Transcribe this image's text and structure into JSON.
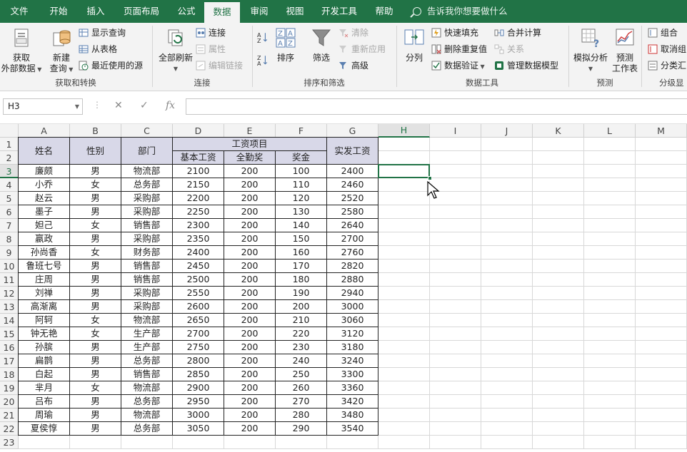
{
  "ribbon_tabs": [
    "文件",
    "开始",
    "插入",
    "页面布局",
    "公式",
    "数据",
    "审阅",
    "视图",
    "开发工具",
    "帮助"
  ],
  "active_tab": "数据",
  "tell_me": "告诉我你想要做什么",
  "groups": {
    "get_transform": {
      "label": "获取和转换",
      "get_external": [
        "获取",
        "外部数据"
      ],
      "new_query": [
        "新建",
        "查询"
      ],
      "show_queries": "显示查询",
      "from_table": "从表格",
      "recent_sources": "最近使用的源"
    },
    "connections": {
      "label": "连接",
      "refresh_all": "全部刷新",
      "connections": "连接",
      "properties": "属性",
      "edit_links": "编辑链接"
    },
    "sort_filter": {
      "label": "排序和筛选",
      "sort": "排序",
      "filter": "筛选",
      "clear": "清除",
      "reapply": "重新应用",
      "advanced": "高级"
    },
    "data_tools": {
      "label": "数据工具",
      "text_to_columns": "分列",
      "flash_fill": "快速填充",
      "remove_duplicates": "删除重复值",
      "data_validation": "数据验证",
      "consolidate": "合并计算",
      "relationships": "关系",
      "manage_model": "管理数据模型"
    },
    "forecast": {
      "label": "预测",
      "what_if": "模拟分析",
      "forecast_sheet": [
        "预测",
        "工作表"
      ]
    },
    "outline": {
      "label": "分级显",
      "group": "组合",
      "ungroup": "取消组",
      "subtotal": "分类汇"
    }
  },
  "name_box": "H3",
  "formula_value": "",
  "columns": [
    "A",
    "B",
    "C",
    "D",
    "E",
    "F",
    "G",
    "H",
    "I",
    "J",
    "K",
    "L",
    "M"
  ],
  "rows": [
    "1",
    "2",
    "3",
    "4",
    "5",
    "6",
    "7",
    "8",
    "9",
    "10",
    "11",
    "12",
    "13",
    "14",
    "15",
    "16",
    "17",
    "18",
    "19",
    "20",
    "21",
    "22",
    "23"
  ],
  "selected_cell": "H3",
  "table": {
    "headers": {
      "name": "姓名",
      "gender": "性别",
      "dept": "部门",
      "salary_items": "工资项目",
      "base": "基本工资",
      "attendance": "全勤奖",
      "bonus": "奖金",
      "actual": "实发工资"
    },
    "rows": [
      [
        "廉颇",
        "男",
        "物流部",
        "2100",
        "200",
        "100",
        "2400"
      ],
      [
        "小乔",
        "女",
        "总务部",
        "2150",
        "200",
        "110",
        "2460"
      ],
      [
        "赵云",
        "男",
        "采购部",
        "2200",
        "200",
        "120",
        "2520"
      ],
      [
        "墨子",
        "男",
        "采购部",
        "2250",
        "200",
        "130",
        "2580"
      ],
      [
        "妲己",
        "女",
        "销售部",
        "2300",
        "200",
        "140",
        "2640"
      ],
      [
        "嬴政",
        "男",
        "采购部",
        "2350",
        "200",
        "150",
        "2700"
      ],
      [
        "孙尚香",
        "女",
        "财务部",
        "2400",
        "200",
        "160",
        "2760"
      ],
      [
        "鲁班七号",
        "男",
        "销售部",
        "2450",
        "200",
        "170",
        "2820"
      ],
      [
        "庄周",
        "男",
        "销售部",
        "2500",
        "200",
        "180",
        "2880"
      ],
      [
        "刘禅",
        "男",
        "采购部",
        "2550",
        "200",
        "190",
        "2940"
      ],
      [
        "高渐离",
        "男",
        "采购部",
        "2600",
        "200",
        "200",
        "3000"
      ],
      [
        "阿轲",
        "女",
        "物流部",
        "2650",
        "200",
        "210",
        "3060"
      ],
      [
        "钟无艳",
        "女",
        "生产部",
        "2700",
        "200",
        "220",
        "3120"
      ],
      [
        "孙膑",
        "男",
        "生产部",
        "2750",
        "200",
        "230",
        "3180"
      ],
      [
        "扁鹊",
        "男",
        "总务部",
        "2800",
        "200",
        "240",
        "3240"
      ],
      [
        "白起",
        "男",
        "销售部",
        "2850",
        "200",
        "250",
        "3300"
      ],
      [
        "芈月",
        "女",
        "物流部",
        "2900",
        "200",
        "260",
        "3360"
      ],
      [
        "吕布",
        "男",
        "总务部",
        "2950",
        "200",
        "270",
        "3420"
      ],
      [
        "周瑜",
        "男",
        "物流部",
        "3000",
        "200",
        "280",
        "3480"
      ],
      [
        "夏侯惇",
        "男",
        "总务部",
        "3050",
        "200",
        "290",
        "3540"
      ]
    ]
  },
  "colors": {
    "excel_green": "#217346",
    "header_fill": "#d8d8e8"
  }
}
